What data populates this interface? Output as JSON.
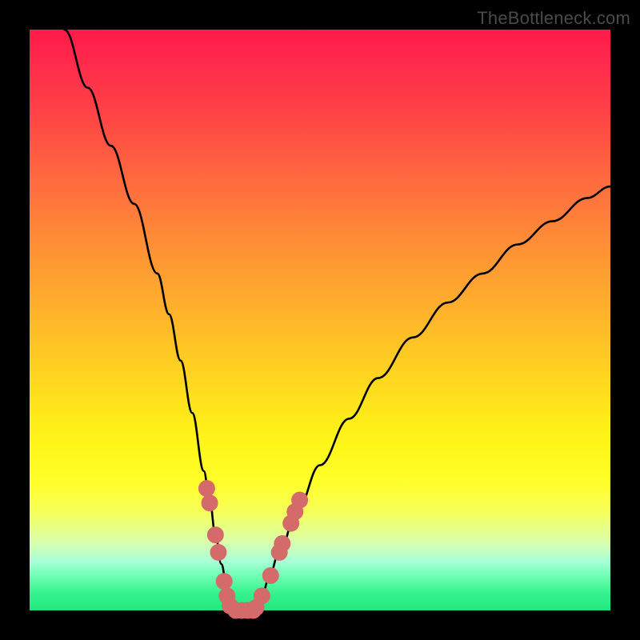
{
  "watermark": "TheBottleneck.com",
  "chart_data": {
    "type": "line",
    "title": "",
    "xlabel": "",
    "ylabel": "",
    "xlim": [
      0,
      100
    ],
    "ylim": [
      0,
      100
    ],
    "series": [
      {
        "name": "bottleneck-curve",
        "x": [
          6,
          10,
          14,
          18,
          22,
          24,
          26,
          28,
          30,
          31,
          32,
          33,
          34,
          35,
          36,
          37,
          38,
          39,
          40,
          41,
          43,
          46,
          50,
          55,
          60,
          66,
          72,
          78,
          84,
          90,
          96,
          100
        ],
        "y": [
          100,
          90,
          80,
          70,
          58,
          51,
          43,
          34,
          24,
          19,
          13,
          8,
          4,
          1,
          0,
          0,
          0,
          0.5,
          2,
          5,
          10,
          17,
          25,
          33,
          40,
          47,
          53,
          58,
          63,
          67,
          71,
          73
        ]
      }
    ],
    "markers": {
      "name": "highlight-markers",
      "color": "#d46a6a",
      "points_xy": [
        [
          30.5,
          21
        ],
        [
          31,
          18.5
        ],
        [
          32,
          13
        ],
        [
          32.5,
          10
        ],
        [
          33.5,
          5
        ],
        [
          34,
          2.5
        ],
        [
          34.5,
          0.8
        ],
        [
          35.5,
          0
        ],
        [
          36.5,
          0
        ],
        [
          37.5,
          0
        ],
        [
          38.5,
          0
        ],
        [
          39,
          0.5
        ],
        [
          40,
          2.5
        ],
        [
          41.5,
          6
        ],
        [
          43,
          10
        ],
        [
          43.5,
          11.5
        ],
        [
          45,
          15
        ],
        [
          45.7,
          17
        ],
        [
          46.5,
          19
        ]
      ]
    }
  }
}
